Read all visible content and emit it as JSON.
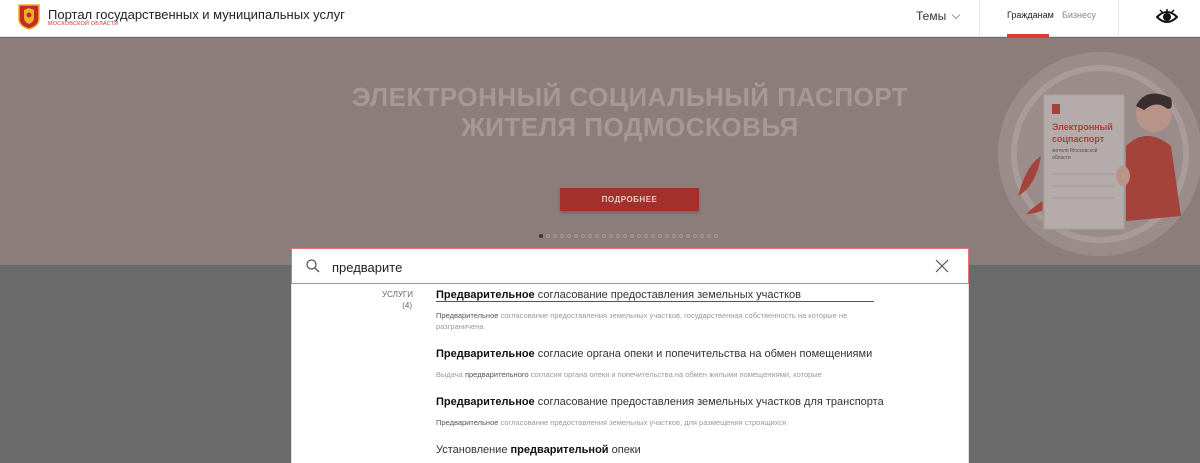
{
  "header": {
    "title": "Портал государственных и муниципальных услуг",
    "subtitle": "МОСКОВСКОЙ ОБЛАСТИ",
    "themes": "Темы",
    "tab_citizens": "Гражданам",
    "tab_business": "Бизнесу"
  },
  "banner": {
    "title_line1": "ЭЛЕКТРОННЫЙ СОЦИАЛЬНЫЙ ПАСПОРТ",
    "title_line2": "ЖИТЕЛЯ ПОДМОСКОВЬЯ",
    "button": "ПОДРОБНЕЕ",
    "card_title_1": "Электронный",
    "card_title_2": "соцпаспорт",
    "card_sub_1": "жителя Московской",
    "card_sub_2": "области",
    "slide_count": 26,
    "active_slide": 1
  },
  "search": {
    "value": "предварите"
  },
  "results": {
    "category": "УСЛУГИ",
    "count": "(4)",
    "items": [
      {
        "title_bold": "Предварительное",
        "title_rest": " согласование предоставления земельных участков",
        "desc_bold": "Предварительное",
        "desc_rest": " согласование предоставления земельных участков, государственная собственность на которые не разграничена"
      },
      {
        "title_bold": "Предварительное",
        "title_rest": " согласие органа опеки и попечительства на обмен помещениями",
        "desc_pre": "Выдача ",
        "desc_bold": "предварительного",
        "desc_rest": " согласия органа опеки и попечительства на обмен жилыми помещениями, которые"
      },
      {
        "title_bold": "Предварительное",
        "title_rest": " согласование предоставления земельных участков для транспорта",
        "desc_bold": "Предварительное",
        "desc_rest": " согласование предоставления земельных участков, для размещения строящихся"
      },
      {
        "title_pre": "Установление ",
        "title_bold": "предварительной",
        "title_rest": " опеки"
      }
    ]
  }
}
